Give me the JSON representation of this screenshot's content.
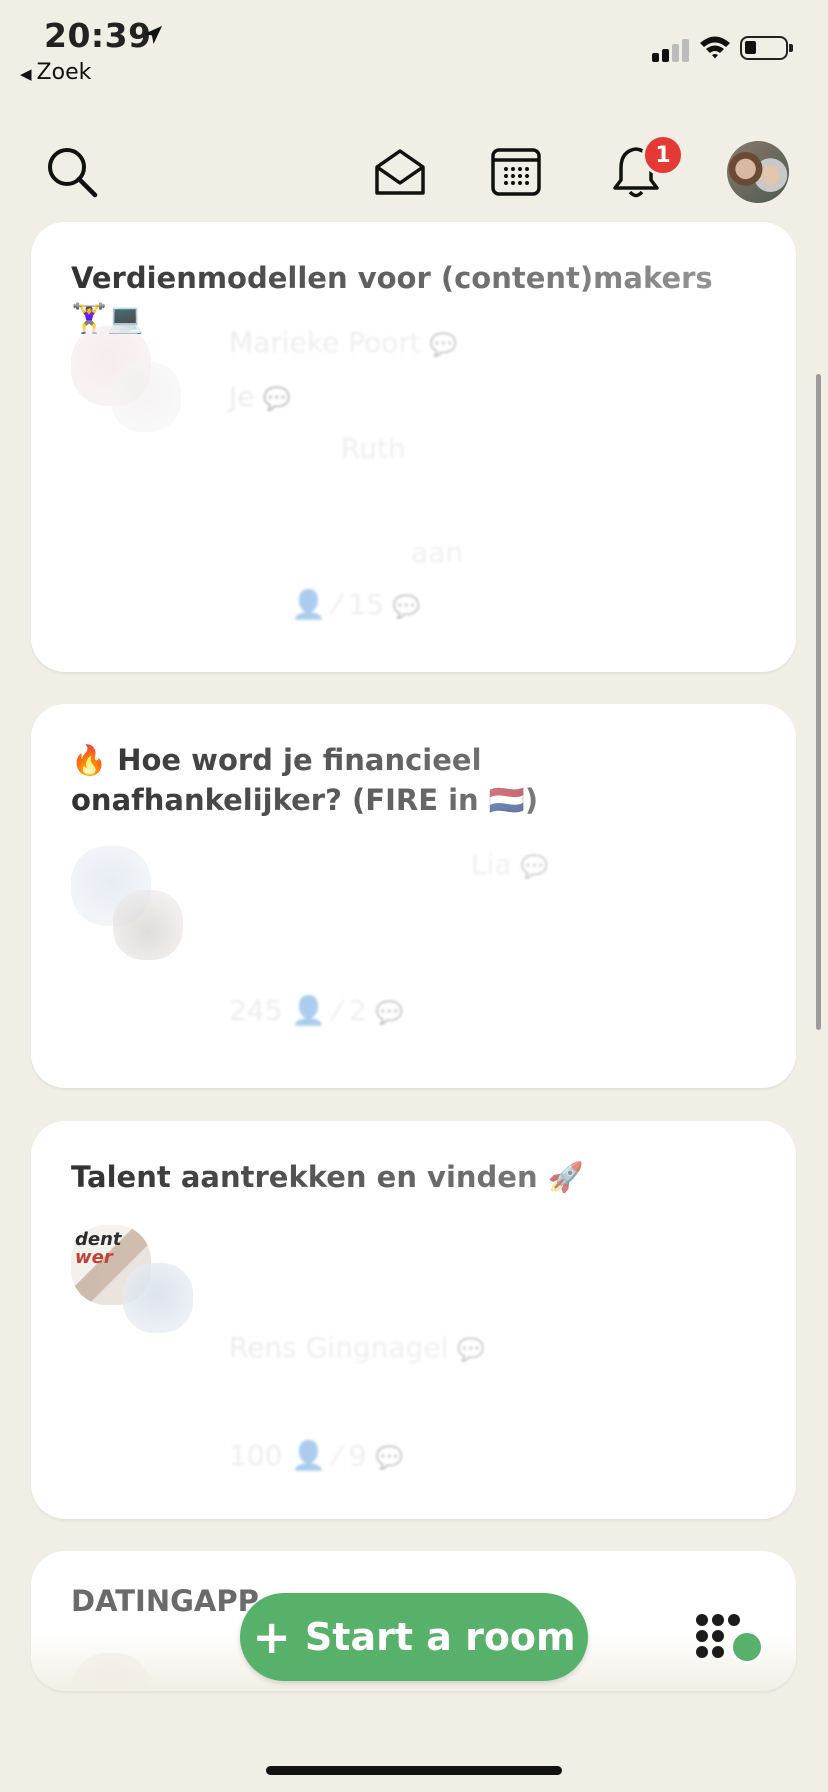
{
  "status_bar": {
    "time": "20:39",
    "back_label": "Zoek",
    "battery_percent": 20
  },
  "nav": {
    "icons": [
      "search-icon",
      "envelope-icon",
      "calendar-icon",
      "bell-icon",
      "profile-avatar"
    ],
    "notification_count": "1"
  },
  "rooms": [
    {
      "title": "Verdienmodellen voor (content)makers 🏋️‍♀️💻",
      "ghost_lines": [
        "Marieke Poort",
        "Je",
        "Ruth",
        "aan",
        "15"
      ]
    },
    {
      "title": "🔥 Hoe word je financieel onafhankelijker? (FIRE in 🇳🇱)",
      "ghost_lines": [
        "Lia",
        "",
        "245",
        "2"
      ]
    },
    {
      "title": "Talent aantrekken en vinden 🚀",
      "ghost_lines": [
        "Rens Gingnagel",
        "100",
        "9"
      ]
    },
    {
      "title": "DATINGAPP",
      "ghost_lines": []
    }
  ],
  "actions": {
    "start_room_label": "Start a room",
    "start_room_icon": "plus-icon"
  },
  "colors": {
    "background": "#f1efe5",
    "accent_green": "#58b16a",
    "badge_red": "#e53935"
  }
}
